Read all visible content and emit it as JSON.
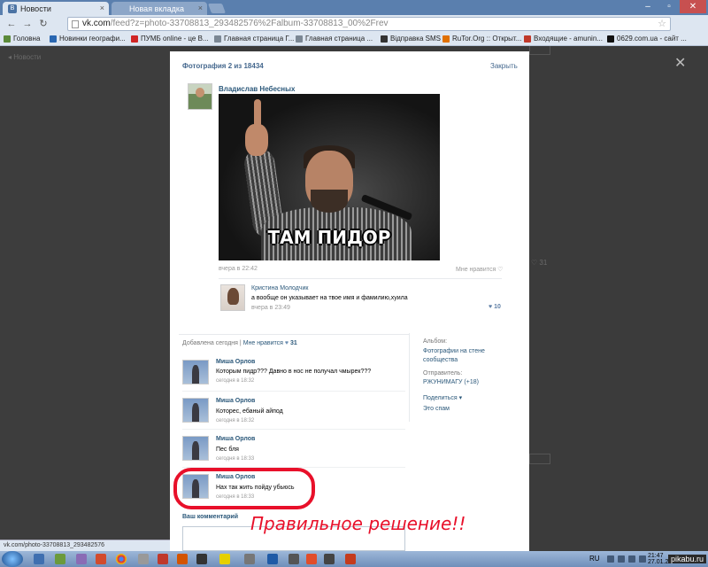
{
  "browser": {
    "tabs": [
      {
        "label": "Новости"
      },
      {
        "label": "Новая вкладка"
      }
    ],
    "address": {
      "host": "vk.com",
      "path": "/feed?z=photo-33708813_293482576%2Falbum-33708813_00%2Frev"
    },
    "bookmarks": [
      {
        "label": "Головна",
        "color": "#5b8a3a"
      },
      {
        "label": "Новинки географи...",
        "color": "#2a67b1"
      },
      {
        "label": "ПУМБ online - це В...",
        "color": "#d02525"
      },
      {
        "label": "Главная страница Г...",
        "color": "#7b8794"
      },
      {
        "label": "Главная страница ...",
        "color": "#7b8794"
      },
      {
        "label": "Відправка SMS",
        "color": "#333333"
      },
      {
        "label": "RuTor.Org :: Открыт...",
        "color": "#e07000"
      },
      {
        "label": "Входящие - amunin...",
        "color": "#c0392b"
      },
      {
        "label": "0629.com.ua - сайт ...",
        "color": "#111111"
      }
    ],
    "status_url": "vk.com/photo-33708813_293482576"
  },
  "bg": {
    "back": "Новости",
    "count": "31"
  },
  "modal": {
    "header": "Фотография 2 из 18434",
    "close": "Закрыть",
    "author": "Владислав Небесных",
    "photo_caption": "ТАМ ПИДОР",
    "photo_time": "вчера в 22:42",
    "photo_like": "Мне нравится ♡",
    "top_comment": {
      "name": "Кристина Молодчик",
      "text": "а вообще он указывает на твое имя и фамилию,хуила",
      "time": "вчера в 23:49",
      "likes": "♥ 10"
    },
    "added": {
      "label": "Добавлена сегодня",
      "sep": "|",
      "like": "Мне нравится",
      "heart": "♥",
      "count": "31"
    },
    "comments": [
      {
        "name": "Миша Орлов",
        "text": "Которым пидр??? Давно в нос не получал чмырек???",
        "time": "сегодня в 18:32"
      },
      {
        "name": "Миша Орлов",
        "text": "Которес, ебаный айпод",
        "time": "сегодня в 18:32"
      },
      {
        "name": "Миша Орлов",
        "text": "Пес бля",
        "time": "сегодня в 18:33"
      },
      {
        "name": "Миша Орлов",
        "text": "Нах так жить пойду убьюсь",
        "time": "сегодня в 18:33"
      }
    ],
    "side": {
      "album_label": "Альбом:",
      "album_value": "Фотографии на стене сообщества",
      "sender_label": "Отправитель:",
      "sender_value": "РЖУНИМАГУ (+18)",
      "share": "Поделиться ▾",
      "spam": "Это спам"
    },
    "your_comment": "Ваш комментарий"
  },
  "annotation": "Правильное решение!!",
  "taskbar": {
    "lang": "RU",
    "time": "21:47",
    "date": "27.01.2013"
  },
  "watermark": "pikabu.ru"
}
